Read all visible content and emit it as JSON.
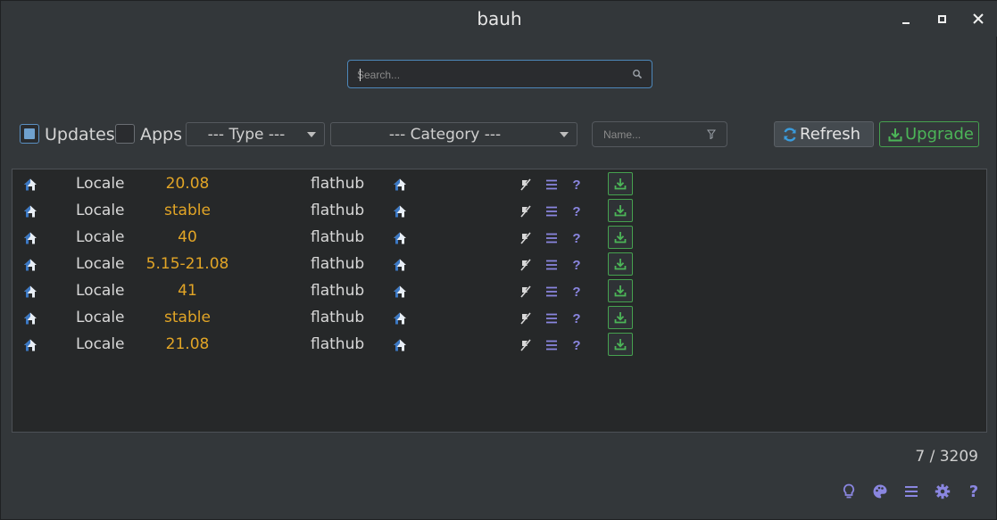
{
  "window": {
    "title": "bauh"
  },
  "search": {
    "placeholder": "Search...",
    "value": ""
  },
  "filters": {
    "updates_label": "Updates",
    "updates_checked": true,
    "apps_label": "Apps",
    "apps_checked": false,
    "type_selected": "--- Type ---",
    "category_selected": "--- Category ---",
    "name_placeholder": "Name..."
  },
  "buttons": {
    "refresh_label": "Refresh",
    "upgrade_label": "Upgrade"
  },
  "table": {
    "rows": [
      {
        "name": "Locale",
        "version": "20.08",
        "repository": "flathub"
      },
      {
        "name": "Locale",
        "version": "stable",
        "repository": "flathub"
      },
      {
        "name": "Locale",
        "version": "40",
        "repository": "flathub"
      },
      {
        "name": "Locale",
        "version": "5.15-21.08",
        "repository": "flathub"
      },
      {
        "name": "Locale",
        "version": "41",
        "repository": "flathub"
      },
      {
        "name": "Locale",
        "version": "stable",
        "repository": "flathub"
      },
      {
        "name": "Locale",
        "version": "21.08",
        "repository": "flathub"
      }
    ]
  },
  "footer": {
    "count": "7 / 3209",
    "icons": [
      "lightbulb-icon",
      "palette-icon",
      "menu-icon",
      "settings-icon",
      "help-icon"
    ],
    "help_glyph": "?"
  },
  "row_actions": {
    "help_glyph": "?"
  },
  "colors": {
    "accent_blue": "#4d87b9",
    "version_orange": "#e2a526",
    "upgrade_green": "#46a14f",
    "icon_purple": "#8a86e0"
  }
}
